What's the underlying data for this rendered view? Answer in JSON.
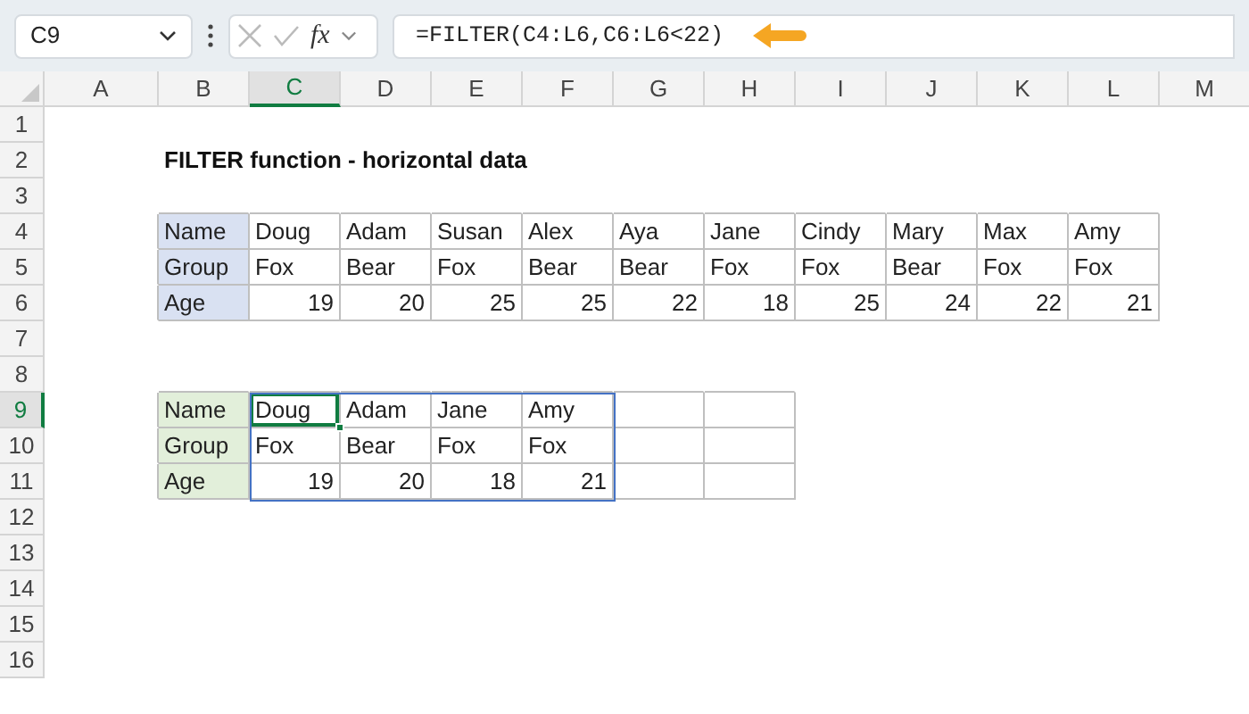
{
  "formula_bar": {
    "name_box": "C9",
    "fx_label": "fx",
    "formula": "=FILTER(C4:L6,C6:L6<22)"
  },
  "columns": [
    {
      "label": "A",
      "selected": false
    },
    {
      "label": "B",
      "selected": false
    },
    {
      "label": "C",
      "selected": true
    },
    {
      "label": "D",
      "selected": false
    },
    {
      "label": "E",
      "selected": false
    },
    {
      "label": "F",
      "selected": false
    },
    {
      "label": "G",
      "selected": false
    },
    {
      "label": "H",
      "selected": false
    },
    {
      "label": "I",
      "selected": false
    },
    {
      "label": "J",
      "selected": false
    },
    {
      "label": "K",
      "selected": false
    },
    {
      "label": "L",
      "selected": false
    },
    {
      "label": "M",
      "selected": false
    }
  ],
  "rows": [
    {
      "label": "1",
      "selected": false
    },
    {
      "label": "2",
      "selected": false
    },
    {
      "label": "3",
      "selected": false
    },
    {
      "label": "4",
      "selected": false
    },
    {
      "label": "5",
      "selected": false
    },
    {
      "label": "6",
      "selected": false
    },
    {
      "label": "7",
      "selected": false
    },
    {
      "label": "8",
      "selected": false
    },
    {
      "label": "9",
      "selected": true
    },
    {
      "label": "10",
      "selected": false
    },
    {
      "label": "11",
      "selected": false
    },
    {
      "label": "12",
      "selected": false
    },
    {
      "label": "13",
      "selected": false
    },
    {
      "label": "14",
      "selected": false
    },
    {
      "label": "15",
      "selected": false
    },
    {
      "label": "16",
      "selected": false
    }
  ],
  "title": "FILTER function - horizontal data",
  "source_table": {
    "rows": [
      {
        "label": "Name",
        "kind": "text",
        "values": [
          "Doug",
          "Adam",
          "Susan",
          "Alex",
          "Aya",
          "Jane",
          "Cindy",
          "Mary",
          "Max",
          "Amy"
        ]
      },
      {
        "label": "Group",
        "kind": "text",
        "values": [
          "Fox",
          "Bear",
          "Fox",
          "Bear",
          "Bear",
          "Fox",
          "Fox",
          "Bear",
          "Fox",
          "Fox"
        ]
      },
      {
        "label": "Age",
        "kind": "number",
        "values": [
          "19",
          "20",
          "25",
          "25",
          "22",
          "18",
          "25",
          "24",
          "22",
          "21"
        ]
      }
    ]
  },
  "result_table": {
    "spill": true,
    "rows": [
      {
        "label": "Name",
        "kind": "text",
        "values": [
          "Doug",
          "Adam",
          "Jane",
          "Amy"
        ]
      },
      {
        "label": "Group",
        "kind": "text",
        "values": [
          "Fox",
          "Bear",
          "Fox",
          "Fox"
        ]
      },
      {
        "label": "Age",
        "kind": "number",
        "values": [
          "19",
          "20",
          "18",
          "21"
        ]
      }
    ]
  }
}
